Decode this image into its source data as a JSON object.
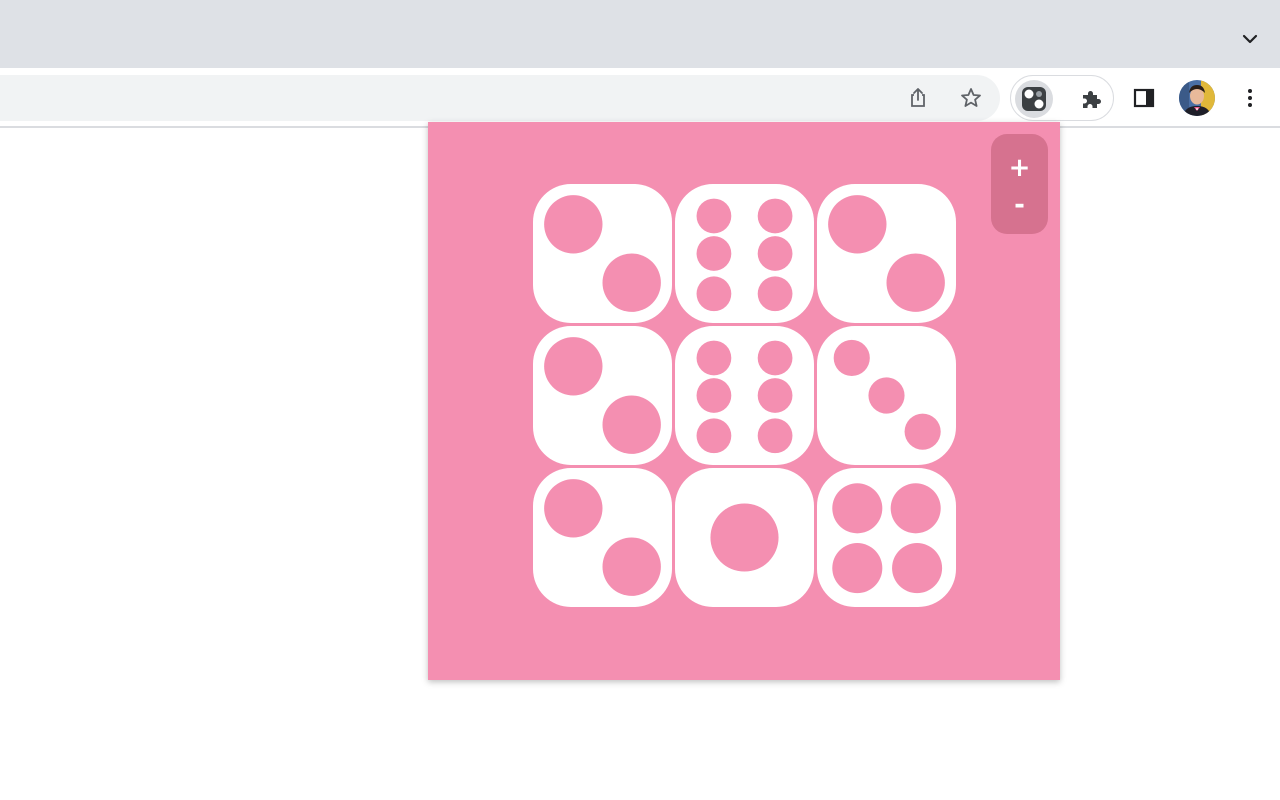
{
  "browser": {
    "tabstrip_icon": "chevron-down-icon",
    "toolbar_icons": [
      "share-icon",
      "star-icon",
      "dice-extension-icon",
      "puzzle-extensions-icon",
      "side-panel-icon",
      "avatar",
      "kebab-menu-icon"
    ]
  },
  "popup": {
    "background_color": "#f48fb1",
    "die_color": "#ffffff",
    "pip_color": "#f48fb1",
    "grid": [
      [
        2,
        6,
        2
      ],
      [
        2,
        6,
        3
      ],
      [
        2,
        1,
        4
      ]
    ],
    "zoom": {
      "zoom_in_label": "+",
      "zoom_out_label": "-"
    }
  }
}
